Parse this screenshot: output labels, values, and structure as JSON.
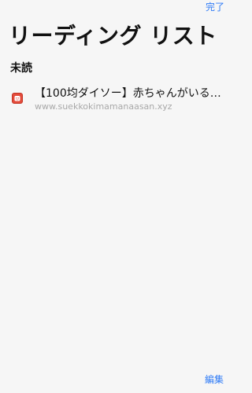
{
  "header": {
    "done_label": "完了",
    "title": "リーディング リスト"
  },
  "section": {
    "label": "未読"
  },
  "items": [
    {
      "title": "【100均ダイソー】赤ちゃんがいる…",
      "url": "www.suekkokimamanaasan.xyz",
      "icon": "site-favicon-icon"
    }
  ],
  "footer": {
    "edit_label": "編集"
  },
  "colors": {
    "accent": "#2f7bf6",
    "background": "#f6f6f6",
    "secondary_text": "#a8a8a8",
    "favicon": "#e44b3b"
  }
}
